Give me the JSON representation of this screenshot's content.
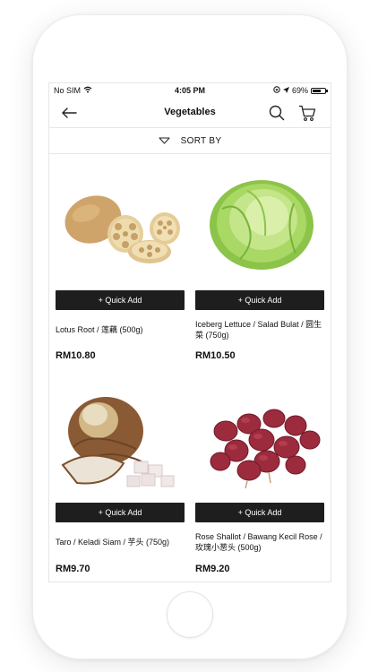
{
  "status": {
    "carrier": "No SIM",
    "time": "4:05 PM",
    "battery": "69%",
    "battery_level": 0.69
  },
  "nav": {
    "title": "Vegetables"
  },
  "sort": {
    "label": "SORT BY"
  },
  "products": [
    {
      "name": "Lotus Root / 莲藕 (500g)",
      "price": "RM10.80",
      "button": "+ Quick Add"
    },
    {
      "name": "Iceberg Lettuce / Salad Bulat / 圆生菜 (750g)",
      "price": "RM10.50",
      "button": "+ Quick Add"
    },
    {
      "name": "Taro / Keladi Siam / 芋头 (750g)",
      "price": "RM9.70",
      "button": "+ Quick Add"
    },
    {
      "name": "Rose Shallot / Bawang Kecil Rose / 玫瑰小葱头 (500g)",
      "price": "RM9.20",
      "button": "+ Quick Add"
    }
  ]
}
